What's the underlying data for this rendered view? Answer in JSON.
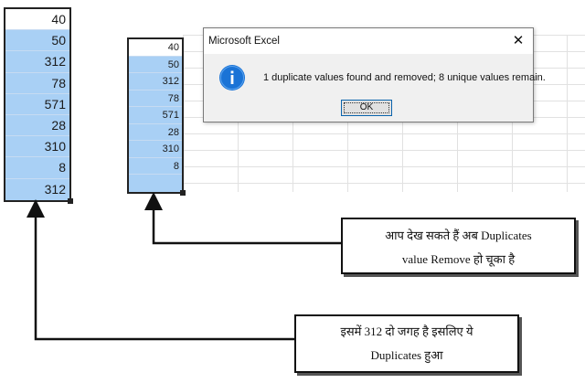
{
  "left_column": {
    "values": [
      "40",
      "50",
      "312",
      "78",
      "571",
      "28",
      "310",
      "8",
      "312"
    ]
  },
  "middle_column": {
    "values": [
      "40",
      "50",
      "312",
      "78",
      "571",
      "28",
      "310",
      "8",
      ""
    ]
  },
  "dialog": {
    "title": "Microsoft Excel",
    "close_glyph": "✕",
    "icon": "info-icon",
    "message": "1 duplicate values found and removed; 8 unique values remain.",
    "ok_label": "OK"
  },
  "callout_top": {
    "line1": "आप देख सकते हैं अब Duplicates",
    "line2": "value Remove हो चूका है"
  },
  "callout_bottom": {
    "line1": "इसमें 312 दो जगह है इसलिए ये",
    "line2": "Duplicates हुआ"
  },
  "colors": {
    "selection": "#a9d0f5",
    "dialog_bg": "#f0f0f0",
    "info_blue": "#1a73d6",
    "ok_border": "#0a64ad"
  }
}
